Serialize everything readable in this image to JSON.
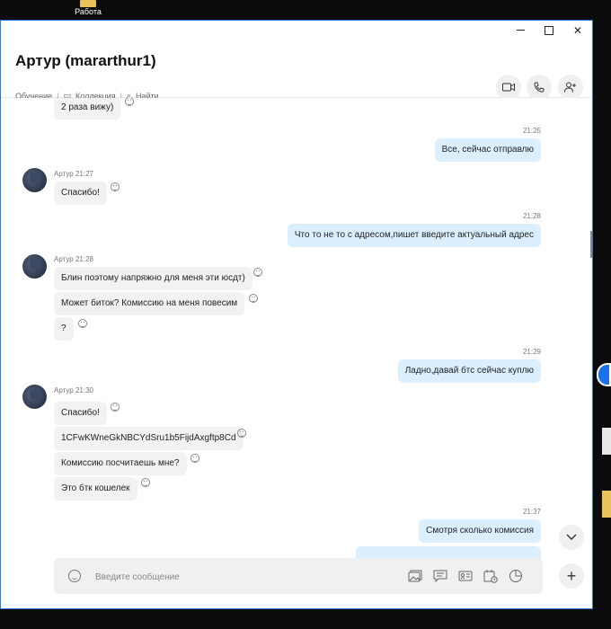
{
  "desktop": {
    "top_icon_label": "Работа"
  },
  "window": {
    "title": "Артур (mararthur1)",
    "meta": {
      "tag1": "Обучение",
      "tag2": "Коллекция",
      "search": "Найти"
    }
  },
  "messages": [
    {
      "dir": "in",
      "text": "2 раза вижу)"
    },
    {
      "dir": "out",
      "time": "21:25",
      "text": "Все, сейчас отправлю"
    },
    {
      "dir": "in",
      "sender": "Артур 21:27",
      "text": "Спасибо!"
    },
    {
      "dir": "out",
      "time": "21:28",
      "text": "Что то не то с адресом,пишет введите актуальный адрес"
    },
    {
      "dir": "in",
      "sender": "Артур 21:28",
      "text": "Блин поэтому напряжно для меня эти юсдт)"
    },
    {
      "dir": "in",
      "text": "Может биток? Комиссию на меня повесим"
    },
    {
      "dir": "in",
      "text": "?"
    },
    {
      "dir": "out",
      "time": "21:29",
      "text": "Ладно,давай бтс сейчас куплю"
    },
    {
      "dir": "in",
      "sender": "Артур 21:30",
      "text": "Спасибо!"
    },
    {
      "dir": "in",
      "text": "1CFwKWneGkNBCYdSru1b5FijdAxgftp8Cd"
    },
    {
      "dir": "in",
      "text": "Комиссию посчитаешь мне?"
    },
    {
      "dir": "in",
      "text": "Это бтк кошелек"
    },
    {
      "dir": "out",
      "time": "21:37",
      "text": "Смотря сколько комиссия"
    }
  ],
  "composer": {
    "placeholder": "Введите сообщение"
  },
  "icons": [
    "video-call-icon",
    "phone-icon",
    "add-person-icon",
    "chevron-down-icon",
    "plus-icon",
    "emoji-icon",
    "media-gallery-icon",
    "contact-card-icon",
    "schedule-icon",
    "poll-icon"
  ]
}
